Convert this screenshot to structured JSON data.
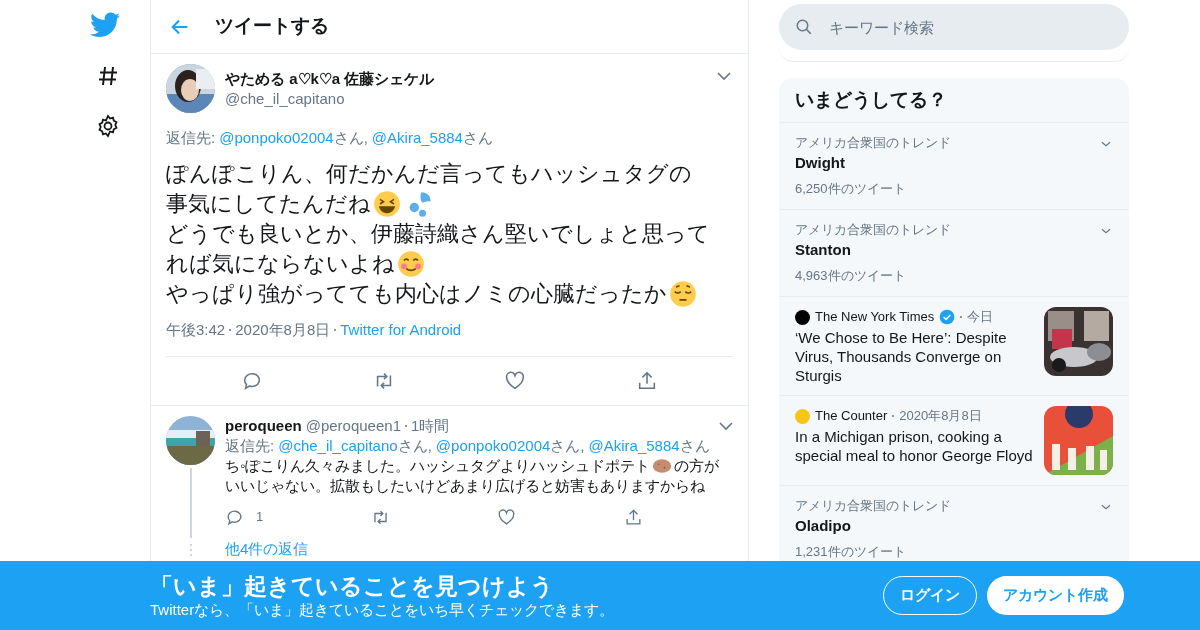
{
  "header": {
    "title": "ツイートする"
  },
  "tweet": {
    "name": "やためる a♡k♡a 佐藤シェケル",
    "handle": "@che_il_capitano",
    "reply_label": "返信先:",
    "reply_to": [
      {
        "handle": "@ponpoko02004",
        "suffix": "さん,"
      },
      {
        "handle": "@Akira_5884",
        "suffix": "さん"
      }
    ],
    "body": [
      [
        {
          "kind": "text",
          "text": "ぽんぽこりん、何だかんだ言ってもハッシュタグの"
        }
      ],
      [
        {
          "kind": "text",
          "text": "事気にしてたんだね"
        },
        {
          "kind": "grin"
        },
        {
          "kind": "drops"
        }
      ],
      [
        {
          "kind": "text",
          "text": "どうでも良いとか、伊藤詩織さん堅いでしょと思って"
        }
      ],
      [
        {
          "kind": "text",
          "text": "れば気にならないよね"
        },
        {
          "kind": "blush"
        }
      ],
      [
        {
          "kind": "text",
          "text": "やっぱり強がってても内心はノミの心臓だったか"
        },
        {
          "kind": "relieved"
        }
      ]
    ],
    "time": "午後3:42",
    "date": "2020年8月8日",
    "source": "Twitter for Android"
  },
  "reply": {
    "name": "peroqueen",
    "handle": "@peroqueen1",
    "age": "1時間",
    "reply_label": "返信先:",
    "reply_to": [
      {
        "handle": "@che_il_capitano",
        "suffix": "さん,"
      },
      {
        "handle": "@ponpoko02004",
        "suffix": "さん,"
      },
      {
        "handle": "@Akira_5884",
        "suffix": "さん"
      }
    ],
    "body": [
      [
        {
          "kind": "text",
          "text": "ち◦ぽこりん久々みました。ハッシュタグよりハッシュドポテト"
        },
        {
          "kind": "potato"
        },
        {
          "kind": "text",
          "text": "の方が"
        }
      ],
      [
        {
          "kind": "text",
          "text": "いいじゃない。拡散もしたいけどあまり広げると妨害もありますからね"
        }
      ]
    ],
    "reply_count": "1",
    "more_replies": "他4件の返信"
  },
  "search": {
    "placeholder": "キーワード検索"
  },
  "trends": {
    "title": "いまどうしてる？",
    "items": [
      {
        "kind": "trend",
        "context": "アメリカ合衆国のトレンド",
        "topic": "Dwight",
        "count": "6,250件のツイート"
      },
      {
        "kind": "trend",
        "context": "アメリカ合衆国のトレンド",
        "topic": "Stanton",
        "count": "4,963件のツイート"
      },
      {
        "kind": "news",
        "source": "The New York Times",
        "verified": true,
        "color": "#000000",
        "time": "今日",
        "headline": "‘We Chose to Be Here’: Despite Virus, Thousands Converge on Sturgis"
      },
      {
        "kind": "news",
        "source": "The Counter",
        "verified": false,
        "color": "#f5c518",
        "time": "2020年8月8日",
        "headline": "In a Michigan prison, cooking a special meal to honor George Floyd"
      },
      {
        "kind": "trend",
        "context": "アメリカ合衆国のトレンド",
        "topic": "Oladipo",
        "count": "1,231件のツイート"
      }
    ]
  },
  "banner": {
    "title": "「いま」起きていることを見つけよう",
    "subtitle": "Twitterなら、「いま」起きていることをいち早くチェックできます。",
    "buttons": [
      {
        "kind": "outline",
        "label": "ログイン"
      },
      {
        "kind": "solid",
        "label": "アカウント作成"
      }
    ]
  }
}
